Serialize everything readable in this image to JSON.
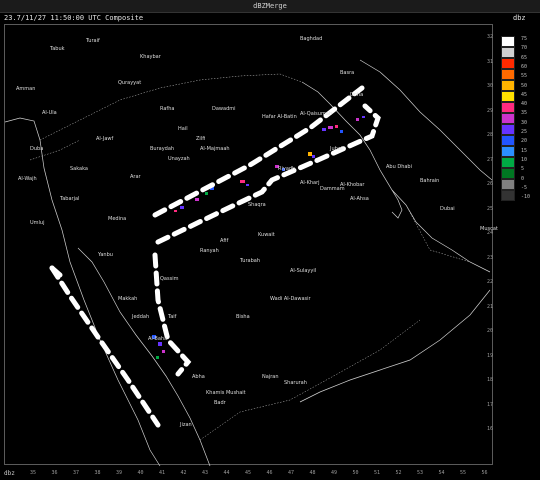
{
  "window": {
    "title": "dBZMerge"
  },
  "header": {
    "timestamp": "23.7/11/27 11:50:00 UTC Composite",
    "units": "dbz"
  },
  "footer": {
    "corner": "dbz"
  },
  "legend": {
    "colors": [
      "#ffffff",
      "#d0d0d0",
      "#ff2a00",
      "#ff6a00",
      "#ffb300",
      "#ffe000",
      "#ff2b7f",
      "#cc33cc",
      "#6633ff",
      "#2255ff",
      "#2b8fff",
      "#00aa44",
      "#007722",
      "#808080",
      "#333333"
    ],
    "ticks": [
      "75",
      "70",
      "65",
      "60",
      "55",
      "50",
      "45",
      "40",
      "35",
      "30",
      "25",
      "20",
      "15",
      "10",
      "5",
      "0",
      "-5",
      "-10"
    ]
  },
  "axes": {
    "lon": [
      "35",
      "36",
      "37",
      "38",
      "39",
      "40",
      "41",
      "42",
      "43",
      "44",
      "45",
      "46",
      "47",
      "48",
      "49",
      "50",
      "51",
      "52",
      "53",
      "54",
      "55",
      "56"
    ],
    "lat": [
      "32",
      "31",
      "30",
      "29",
      "28",
      "27",
      "26",
      "25",
      "24",
      "23",
      "22",
      "21",
      "20",
      "19",
      "18",
      "17",
      "16"
    ]
  },
  "places": [
    "Tabuk",
    "Turaif",
    "Qurayyat",
    "Al-Jawf",
    "Sakaka",
    "Arar",
    "Rafha",
    "Hail",
    "Buraydah",
    "Unayzah",
    "Al-Majmaah",
    "Zilfi",
    "Dawadmi",
    "Riyadh",
    "Al-Kharj",
    "Jubail",
    "Dammam",
    "Al-Khobar",
    "Al-Ahsa",
    "Hafar Al-Batin",
    "Al-Qaisumah",
    "Medina",
    "Yanbu",
    "Makkah",
    "Jeddah",
    "Taif",
    "Al-Baha",
    "Abha",
    "Khamis Mushait",
    "Najran",
    "Jizan",
    "Bisha",
    "Wadi Al-Dawasir",
    "Al-Sulayyil",
    "Tabarjal",
    "Al-Ula",
    "Khaybar",
    "Umluj",
    "Al-Wajh",
    "Duba",
    "Qassim",
    "Shaqra",
    "Afif",
    "Ranyah",
    "Turabah",
    "Kuwait",
    "Doha",
    "Bahrain",
    "Abu Dhabi",
    "Dubai",
    "Muscat",
    "Baghdad",
    "Basra",
    "Amman",
    "Sharurah",
    "Badr"
  ]
}
